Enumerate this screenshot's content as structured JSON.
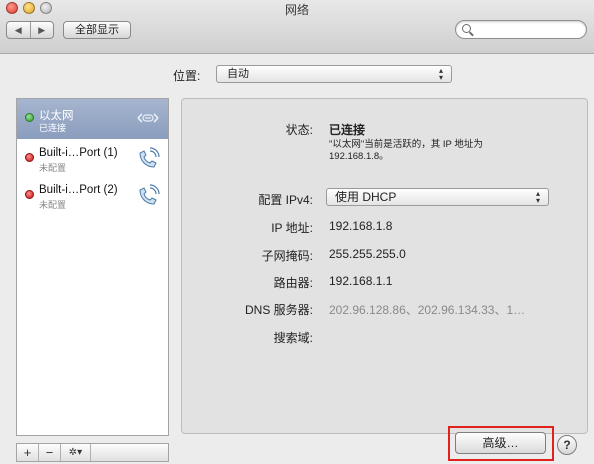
{
  "window": {
    "title": "网络",
    "back_glyph": "◀",
    "forward_glyph": "▶",
    "show_all_label": "全部显示",
    "search_placeholder": ""
  },
  "location": {
    "label": "位置:",
    "value": "自动"
  },
  "services": [
    {
      "name": "以太网",
      "status": "已连接",
      "status_color": "#3bb33b",
      "icon": "ethernet-arrows-icon",
      "selected": true
    },
    {
      "name": "Built-i…Port (1)",
      "status": "未配置",
      "status_color": "#d92020",
      "icon": "phone-modem-icon",
      "selected": false
    },
    {
      "name": "Built-i…Port (2)",
      "status": "未配置",
      "status_color": "#d92020",
      "icon": "phone-modem-icon",
      "selected": false
    }
  ],
  "list_toolbar": {
    "add": "+",
    "remove": "−",
    "gear": "✲▾"
  },
  "detail": {
    "status_label": "状态:",
    "status_value": "已连接",
    "status_note_line1": "\"以太网\"当前是活跃的，其 IP 地址为",
    "status_note_line2": "192.168.1.8。",
    "ipv4_label": "配置 IPv4:",
    "ipv4_value": "使用 DHCP",
    "ip_label": "IP 地址:",
    "ip_value": "192.168.1.8",
    "mask_label": "子网掩码:",
    "mask_value": "255.255.255.0",
    "router_label": "路由器:",
    "router_value": "192.168.1.1",
    "dns_label": "DNS 服务器:",
    "dns_value": "202.96.128.86、202.96.134.33、1…",
    "search_domain_label": "搜索域:"
  },
  "buttons": {
    "advanced": "高级…",
    "help": "?"
  },
  "colors": {
    "selection": "#8a9dbd",
    "highlight_box": "#e0211c"
  }
}
